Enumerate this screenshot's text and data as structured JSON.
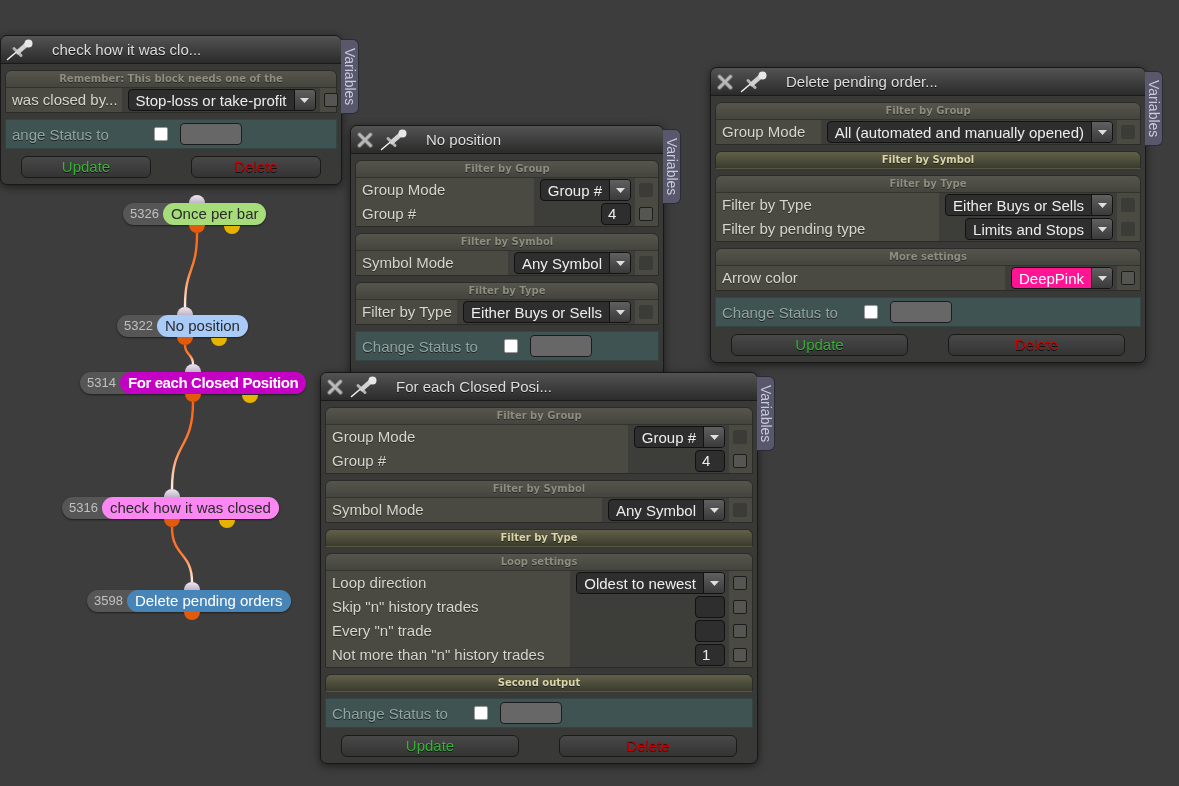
{
  "canvas": {
    "nodes": [
      {
        "number": "5326",
        "title": "Once per bar",
        "color": "#a6dc7a",
        "selected": false,
        "second_output": true,
        "linked_to_next": true
      },
      {
        "number": "5322",
        "title": "No position",
        "color": "#a8cbf8",
        "selected": false,
        "second_output": true,
        "linked_to_next": true
      },
      {
        "number": "5314",
        "title": "For each Closed Position",
        "color": "#c400c4",
        "selected": true,
        "second_output": true,
        "linked_to_next": true
      },
      {
        "number": "5316",
        "title": "check how it was closed",
        "color": "#fb88f2",
        "selected": false,
        "second_output": true,
        "linked_to_next": true
      },
      {
        "number": "3598",
        "title": "Delete pending orders",
        "color": "#4784b8",
        "selected": false,
        "second_output": false,
        "linked_to_next": false
      }
    ]
  },
  "windows": [
    {
      "title": "check how it was clo...",
      "closable": false,
      "side_tab": "Variables",
      "sections": [
        {
          "header": "Remember: This block needs one of the",
          "collapsed": false,
          "rows": [
            {
              "label": "was closed by...",
              "kind": "dropdown",
              "value": "Stop-loss or take-profit",
              "check_disabled": false
            }
          ]
        }
      ],
      "status": {
        "label": "ange Status to",
        "checked": false
      },
      "buttons": [
        {
          "label": "Update",
          "kind": "update"
        },
        {
          "label": "Delete",
          "kind": "delete"
        }
      ]
    },
    {
      "title": "Delete pending order...",
      "closable": true,
      "side_tab": "Variables",
      "sections": [
        {
          "header": "Filter by Group",
          "collapsed": false,
          "rows": [
            {
              "label": "Group Mode",
              "kind": "dropdown",
              "value": "All (automated and manually opened)",
              "check_disabled": true
            }
          ]
        },
        {
          "header": "Filter by Symbol",
          "collapsed": true
        },
        {
          "header": "Filter by Type",
          "collapsed": false,
          "rows": [
            {
              "label": "Filter by Type",
              "kind": "dropdown",
              "value": "Either Buys or Sells",
              "check_disabled": true
            },
            {
              "label": "Filter by pending type",
              "kind": "dropdown",
              "value": "Limits and Stops",
              "check_disabled": true
            }
          ]
        },
        {
          "header": "More settings",
          "collapsed": false,
          "rows": [
            {
              "label": "Arrow color",
              "kind": "color",
              "value": "DeepPink",
              "color": "#ff1493",
              "check_disabled": false
            }
          ]
        }
      ],
      "status": {
        "label": "Change Status to",
        "checked": false
      },
      "buttons": [
        {
          "label": "Update",
          "kind": "update"
        },
        {
          "label": "Delete",
          "kind": "delete"
        }
      ]
    },
    {
      "title": "No position",
      "closable": true,
      "side_tab": "Variables",
      "sections": [
        {
          "header": "Filter by Group",
          "collapsed": false,
          "rows": [
            {
              "label": "Group Mode",
              "kind": "dropdown",
              "value": "Group #",
              "check_disabled": true
            },
            {
              "label": "Group #",
              "kind": "number",
              "value": "4",
              "check_disabled": false
            }
          ]
        },
        {
          "header": "Filter by Symbol",
          "collapsed": false,
          "rows": [
            {
              "label": "Symbol Mode",
              "kind": "dropdown",
              "value": "Any Symbol",
              "check_disabled": true
            }
          ]
        },
        {
          "header": "Filter by Type",
          "collapsed": false,
          "rows": [
            {
              "label": "Filter by Type",
              "kind": "dropdown",
              "value": "Either Buys or Sells",
              "check_disabled": true
            }
          ]
        }
      ],
      "status": {
        "label": "Change Status to",
        "checked": false
      }
    },
    {
      "title": "For each Closed Posi...",
      "closable": true,
      "side_tab": "Variables",
      "sections": [
        {
          "header": "Filter by Group",
          "collapsed": false,
          "rows": [
            {
              "label": "Group Mode",
              "kind": "dropdown",
              "value": "Group #",
              "check_disabled": true
            },
            {
              "label": "Group #",
              "kind": "number",
              "value": "4",
              "check_disabled": false
            }
          ]
        },
        {
          "header": "Filter by Symbol",
          "collapsed": false,
          "rows": [
            {
              "label": "Symbol Mode",
              "kind": "dropdown",
              "value": "Any Symbol",
              "check_disabled": true
            }
          ]
        },
        {
          "header": "Filter by Type",
          "collapsed": true
        },
        {
          "header": "Loop settings",
          "collapsed": false,
          "rows": [
            {
              "label": "Loop direction",
              "kind": "dropdown",
              "value": "Oldest to newest",
              "check_disabled": false
            },
            {
              "label": "Skip \"n\" history trades",
              "kind": "number",
              "check_disabled": false
            },
            {
              "label": "Every \"n\" trade",
              "kind": "number",
              "check_disabled": false
            },
            {
              "label": "Not more than \"n\" history trades",
              "kind": "number",
              "value": "1",
              "check_disabled": false
            }
          ]
        },
        {
          "header": "Second output",
          "collapsed": true
        }
      ],
      "status": {
        "label": "Change Status to",
        "checked": false
      },
      "buttons": [
        {
          "label": "Update",
          "kind": "update"
        },
        {
          "label": "Delete",
          "kind": "delete"
        }
      ]
    }
  ]
}
